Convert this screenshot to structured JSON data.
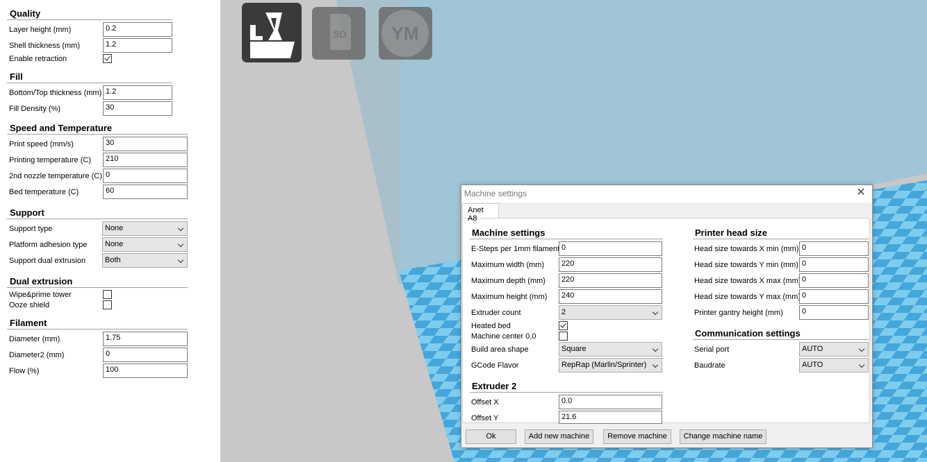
{
  "left_panel": {
    "quality": {
      "title": "Quality",
      "layer_height_label": "Layer height (mm)",
      "layer_height": "0.2",
      "shell_thickness_label": "Shell thickness (mm)",
      "shell_thickness": "1.2",
      "enable_retraction_label": "Enable retraction",
      "enable_retraction": true
    },
    "fill": {
      "title": "Fill",
      "bottom_top_label": "Bottom/Top thickness (mm)",
      "bottom_top": "1.2",
      "fill_density_label": "Fill Density (%)",
      "fill_density": "30"
    },
    "speed": {
      "title": "Speed and Temperature",
      "print_speed_label": "Print speed (mm/s)",
      "print_speed": "30",
      "printing_temp_label": "Printing temperature (C)",
      "printing_temp": "210",
      "nozzle2_temp_label": "2nd nozzle temperature (C)",
      "nozzle2_temp": "0",
      "bed_temp_label": "Bed temperature (C)",
      "bed_temp": "60"
    },
    "support": {
      "title": "Support",
      "support_type_label": "Support type",
      "support_type": "None",
      "platform_adhesion_label": "Platform adhesion type",
      "platform_adhesion": "None",
      "support_dual_label": "Support dual extrusion",
      "support_dual": "Both"
    },
    "dual": {
      "title": "Dual extrusion",
      "wipe_label": "Wipe&prime tower",
      "wipe": false,
      "ooze_label": "Ooze shield",
      "ooze": false
    },
    "filament": {
      "title": "Filament",
      "diameter_label": "Diameter (mm)",
      "diameter": "1.75",
      "diameter2_label": "Diameter2 (mm)",
      "diameter2": "0",
      "flow_label": "Flow (%)",
      "flow": "100"
    }
  },
  "toolbar": {
    "load_icon": "load-model-icon",
    "sd_icon": "sd-card-icon",
    "sd_text": "SD",
    "ym_icon": "youmagine-icon",
    "ym_text": "YM"
  },
  "dialog": {
    "title": "Machine settings",
    "tab": "Anet A8",
    "machine": {
      "title": "Machine settings",
      "esteps_label": "E-Steps per 1mm filament",
      "esteps": "0",
      "max_width_label": "Maximum width (mm)",
      "max_width": "220",
      "max_depth_label": "Maximum depth (mm)",
      "max_depth": "220",
      "max_height_label": "Maximum height (mm)",
      "max_height": "240",
      "extruder_count_label": "Extruder count",
      "extruder_count": "2",
      "heated_bed_label": "Heated bed",
      "heated_bed": true,
      "machine_center_label": "Machine center 0,0",
      "machine_center": false,
      "build_shape_label": "Build area shape",
      "build_shape": "Square",
      "gcode_flavor_label": "GCode Flavor",
      "gcode_flavor": "RepRap (Marlin/Sprinter)"
    },
    "extruder2": {
      "title": "Extruder 2",
      "offset_x_label": "Offset X",
      "offset_x": "0.0",
      "offset_y_label": "Offset Y",
      "offset_y": "21.6"
    },
    "head": {
      "title": "Printer head size",
      "xmin_label": "Head size towards X min (mm)",
      "xmin": "0",
      "ymin_label": "Head size towards Y min (mm)",
      "ymin": "0",
      "xmax_label": "Head size towards X max (mm)",
      "xmax": "0",
      "ymax_label": "Head size towards Y max (mm)",
      "ymax": "0",
      "gantry_label": "Printer gantry height (mm)",
      "gantry": "0"
    },
    "comm": {
      "title": "Communication settings",
      "serial_label": "Serial port",
      "serial": "AUTO",
      "baud_label": "Baudrate",
      "baud": "AUTO"
    },
    "buttons": {
      "ok": "Ok",
      "add": "Add new machine",
      "remove": "Remove machine",
      "rename": "Change machine name"
    }
  },
  "colors": {
    "sky": "#9fc5d6",
    "floor_light": "#7fcdee",
    "floor_dark": "#45a6da",
    "panel_bg": "#ffffff",
    "viewport_gray": "#c8c8c8"
  }
}
